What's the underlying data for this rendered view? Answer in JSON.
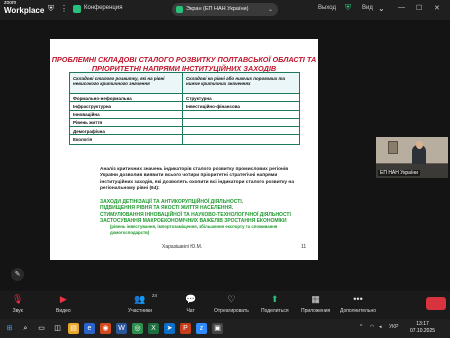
{
  "app": {
    "logo_line1": "zoom",
    "logo_line2": "Workplace"
  },
  "topbar": {
    "conference_label": "Конференция",
    "share_label": "Экран (ЕП НАН України)",
    "exit_label": "Выход",
    "view_label": "Вид"
  },
  "slide": {
    "title": "ПРОБЛЕМНІ СКЛАДОВІ СТАЛОГО РОЗВИТКУ ПОЛТАВСЬКОЇ ОБЛАСТІ ТА ПРІОРИТЕТНІ НАПРЯМИ ІНСТИТУЦІЙНИХ ЗАХОДІВ",
    "table": {
      "headers": [
        "Складові сталого розвитку, які на рівні невисокого критичного значення",
        "Складові на рівні або нижчих порогових та нижче критичних значеннях"
      ],
      "rows": [
        [
          "Формально-неформальна",
          "Структурна"
        ],
        [
          "Інфраструктурна",
          "Інвестиційно-фінансова"
        ],
        [
          "Інноваційна",
          ""
        ],
        [
          "Рівень життя",
          ""
        ],
        [
          "Демографічна",
          ""
        ],
        [
          "Екологія",
          ""
        ]
      ]
    },
    "analysis": "Аналіз критичних значень індикаторів сталого розвитку промислових регіонів України дозволив виявити всього чотири пріоритетні стратегічні напрями інституційних заходів, які дозволять охопити всі індикатори сталого розвитку на регіональному рівні (64):",
    "measures": [
      "ЗАХОДИ ДЕТІНІЗАЦІЇ ТА АНТИКОРУПЦІЙНОЇ ДІЯЛЬНОСТІ.",
      "ПІДВИЩЕННЯ РІВНЯ ТА ЯКОСТІ ЖИТТЯ НАСЕЛЕННЯ.",
      "СТИМУЛЮВАННЯ ІННОВАЦІЙНОЇ ТА НАУКОВО-ТЕХНОЛОГІЧНОЇ ДІЯЛЬНОСТІ",
      "ЗАСТОСУВАННЯ МАКРОЕКОНОМІЧНИХ ВАЖЕЛІВ ЗРОСТАННЯ ЕКОНОМІКИ"
    ],
    "measures_note": "(рівень інвестування, імпортозаміщення, збільшення експорту та споживання домогосподарств)",
    "author": "Харазішвілі Ю.М.",
    "page_number": "11"
  },
  "participant": {
    "name": "ЕП НАН України"
  },
  "controls": {
    "mic_label": "Звук",
    "video_label": "Видео",
    "participants_label": "Участники",
    "participants_count": "24",
    "chat_label": "Чат",
    "react_label": "Отреагировать",
    "share_label": "Поделиться",
    "apps_label": "Приложения",
    "more_label": "Дополнительно"
  },
  "taskbar": {
    "lang": "УКР",
    "time": "13:17",
    "date": "07.10.2025"
  },
  "colors": {
    "title_red": "#c0142b",
    "measures_green": "#1f9a2e",
    "zoom_green": "#27c17a",
    "end_red": "#d8343f"
  }
}
